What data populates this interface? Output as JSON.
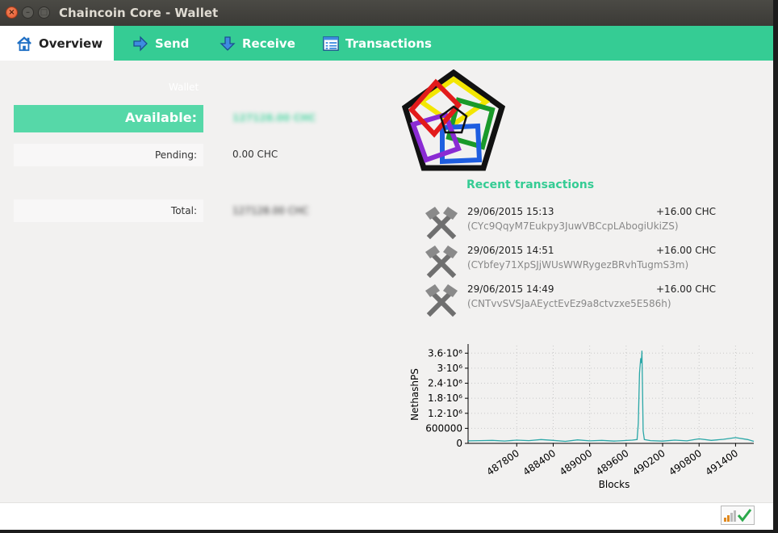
{
  "window": {
    "title": "Chaincoin Core - Wallet"
  },
  "tabs": [
    {
      "label": "Overview",
      "icon": "home-icon"
    },
    {
      "label": "Send",
      "icon": "arrow-right-icon"
    },
    {
      "label": "Receive",
      "icon": "arrow-down-icon"
    },
    {
      "label": "Transactions",
      "icon": "list-icon"
    }
  ],
  "wallet": {
    "label": "Wallet",
    "available_label": "Available:",
    "available_value": "127128.00 CHC",
    "pending_label": "Pending:",
    "pending_value": "0.00 CHC",
    "total_label": "Total:",
    "total_value": "127128.00 CHC"
  },
  "recent": {
    "title": "Recent transactions",
    "items": [
      {
        "date": "29/06/2015 15:13",
        "amount": "+16.00 CHC",
        "address": "(CYc9QqyM7Eukpy3JuwVBCcpLAbogiUkiZS)",
        "icon": "mining-hammers-icon"
      },
      {
        "date": "29/06/2015 14:51",
        "amount": "+16.00 CHC",
        "address": "(CYbfey71XpSJjWUsWWRygezBRvhTugmS3m)",
        "icon": "mining-hammers-icon"
      },
      {
        "date": "29/06/2015 14:49",
        "amount": "+16.00 CHC",
        "address": "(CNTvvSVSJaAEyctEvEz9a8ctvzxe5E586h)",
        "icon": "mining-hammers-icon"
      }
    ]
  },
  "colors": {
    "accent": "#35cc94",
    "accent_light": "#56d8a8",
    "chart_line": "#2aa7a7",
    "titlebar": "#3c3b37"
  },
  "chart_data": {
    "type": "line",
    "xlabel": "Blocks",
    "ylabel": "NethashPS",
    "x_ticks": [
      "487800",
      "488400",
      "489000",
      "489600",
      "490200",
      "490800",
      "491400"
    ],
    "y_ticks": [
      "0",
      "600000",
      "1.2·10⁶",
      "1.8·10⁶",
      "2.4·10⁶",
      "3·10⁶",
      "3.6·10⁶"
    ],
    "xlim": [
      487000,
      491700
    ],
    "ylim": [
      0,
      3900000
    ],
    "grid": true,
    "series": [
      {
        "x": [
          487000,
          487200,
          487400,
          487600,
          487800,
          488000,
          488200,
          488400,
          488600,
          488800,
          489000,
          489200,
          489400,
          489550,
          489700,
          489780,
          489800,
          489820,
          489840,
          489850,
          489860,
          489870,
          489880,
          489900,
          490000,
          490200,
          490400,
          490600,
          490800,
          491000,
          491200,
          491400,
          491600,
          491700
        ],
        "y": [
          100000,
          110000,
          120000,
          95000,
          130000,
          110000,
          150000,
          120000,
          80000,
          140000,
          100000,
          120000,
          90000,
          110000,
          130000,
          150000,
          800000,
          2800000,
          3400000,
          3200000,
          3700000,
          2000000,
          500000,
          150000,
          110000,
          90000,
          130000,
          100000,
          180000,
          120000,
          160000,
          230000,
          150000,
          80000
        ]
      }
    ]
  }
}
